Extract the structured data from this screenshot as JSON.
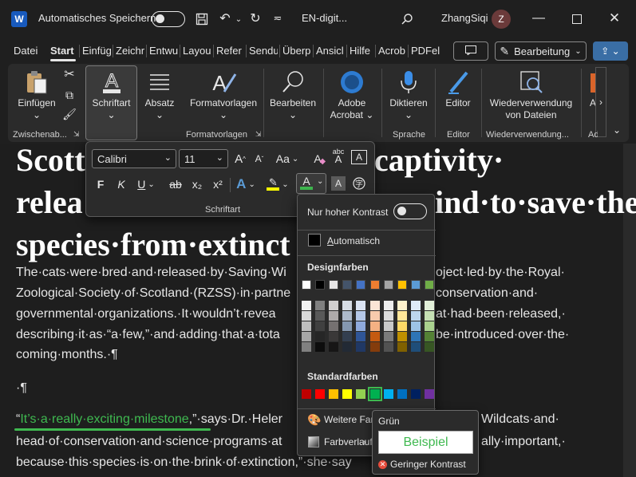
{
  "titlebar": {
    "app_icon": "W",
    "autosave_label": "Automatisches Speichern",
    "doc_title": "EN-digit...",
    "user_name": "ZhangSiqi",
    "avatar_initial": "Z",
    "icons": [
      "save-icon",
      "undo-icon",
      "redo-icon",
      "customize-icon",
      "search-icon",
      "minimize-icon",
      "maximize-icon",
      "close-icon"
    ]
  },
  "tabs": [
    "Datei",
    "Start",
    "Einfüg",
    "Zeichr",
    "Entwu",
    "Layou",
    "Refer",
    "Sendu",
    "Überp",
    "Ansicl",
    "Hilfe",
    "Acrob",
    "PDFel"
  ],
  "actions": {
    "edit_mode": "Bearbeitung"
  },
  "ribbon": {
    "einfuegen": "Einfügen",
    "schriftart": "Schriftart",
    "absatz": "Absatz",
    "formatvorlagen": "Formatvorlagen",
    "bearbeiten": "Bearbeiten",
    "adobe_acrobat_1": "Adobe",
    "adobe_acrobat_2": "Acrobat",
    "diktieren": "Diktieren",
    "editor": "Editor",
    "wiederverwendung_1": "Wiederverwendung",
    "wiederverwendung_2": "von Dateien",
    "cut_off": "A",
    "groups": {
      "zwischenablage": "Zwischenab...",
      "formatvorlagen": "Formatvorlagen",
      "sprache": "Sprache",
      "editor": "Editor",
      "wiederverwendung": "Wiederverwendung...",
      "ad": "Ad"
    }
  },
  "font_popup": {
    "font_name": "Calibri",
    "font_size": "11",
    "group_label": "Schriftart",
    "bold": "F",
    "italic": "K",
    "underline": "U",
    "strikethrough": "ab",
    "subscript": "x₂",
    "superscript": "x²",
    "change_case": "Aa",
    "grow": "A",
    "shrink": "A",
    "font_color_letter": "A",
    "text_effects_letter": "A",
    "shading_letter": "A",
    "char_border_letter": "A",
    "clear_format_letter": "A",
    "phonetic_text": "abc"
  },
  "document": {
    "heading_lines": [
      "Scott",
      "captivity·",
      "relea",
      "ind·to·save·the·",
      "species·from·extinct"
    ],
    "body_lines": [
      "The·cats·were·bred·and·released·by·Saving·Wi",
      "oject·led·by·the·Royal·",
      "Zoological·Society·of·Scotland·(RZSS)·in·partne",
      "conservation·and·",
      "governmental·organizations.·It·wouldn’t·revea",
      "at·had·been·released,·",
      "describing·it·as·“a·few,”·and·adding·that·a·tota",
      "be·introduced·over·the·",
      "coming·months.·¶",
      "·¶"
    ],
    "quote_open": "“",
    "quote_highlight": "It’s·a·really·exciting·milestone",
    "quote_after": ",”·says·Dr.·Heler",
    "quote_right": "Wildcats·and·",
    "line_head": "head·of·conservation·and·science·programs·at",
    "line_head_right": "ally·important,·",
    "line_because": "because·this·species·is·on·the·brink·of·extinction,”·she·say"
  },
  "color_dropdown": {
    "high_contrast_label": "Nur hoher Kontrast",
    "automatic_label": "Automatisch",
    "theme_colors_heading": "Designfarben",
    "standard_colors_heading": "Standardfarben",
    "more_colors_label": "Weitere Farb",
    "gradient_label": "Farbverlauf",
    "theme_top_row": [
      "#ffffff",
      "#000000",
      "#e7e6e6",
      "#44546a",
      "#4472c4",
      "#ed7d31",
      "#a5a5a5",
      "#ffc000",
      "#5b9bd5",
      "#70ad47"
    ],
    "theme_shades": [
      [
        "#f2f2f2",
        "#d9d9d9",
        "#bfbfbf",
        "#a6a6a6",
        "#808080"
      ],
      [
        "#808080",
        "#595959",
        "#404040",
        "#262626",
        "#0d0d0d"
      ],
      [
        "#d0cece",
        "#aeaaaa",
        "#757171",
        "#3a3838",
        "#171616"
      ],
      [
        "#d6dce5",
        "#adb9ca",
        "#8497b0",
        "#333f50",
        "#222a35"
      ],
      [
        "#dae3f3",
        "#b4c7e7",
        "#8faadc",
        "#2f5597",
        "#203864"
      ],
      [
        "#fbe5d6",
        "#f8cbad",
        "#f4b183",
        "#c55a11",
        "#843c0c"
      ],
      [
        "#ededed",
        "#dbdbdb",
        "#c9c9c9",
        "#7b7b7b",
        "#525252"
      ],
      [
        "#fff2cc",
        "#ffe699",
        "#ffd966",
        "#bf9000",
        "#7f6000"
      ],
      [
        "#deebf7",
        "#bdd7ee",
        "#9dc3e6",
        "#2e75b6",
        "#1f4e79"
      ],
      [
        "#e2f0d9",
        "#c5e0b4",
        "#a9d18e",
        "#548235",
        "#375623"
      ]
    ],
    "standard_colors": [
      "#c00000",
      "#ff0000",
      "#ffc000",
      "#ffff00",
      "#92d050",
      "#00b050",
      "#00b0f0",
      "#0070c0",
      "#002060",
      "#7030a0"
    ]
  },
  "tooltip": {
    "color_name": "Grün",
    "preview_text": "Beispiel",
    "contrast_text": "Geringer Kontrast"
  }
}
